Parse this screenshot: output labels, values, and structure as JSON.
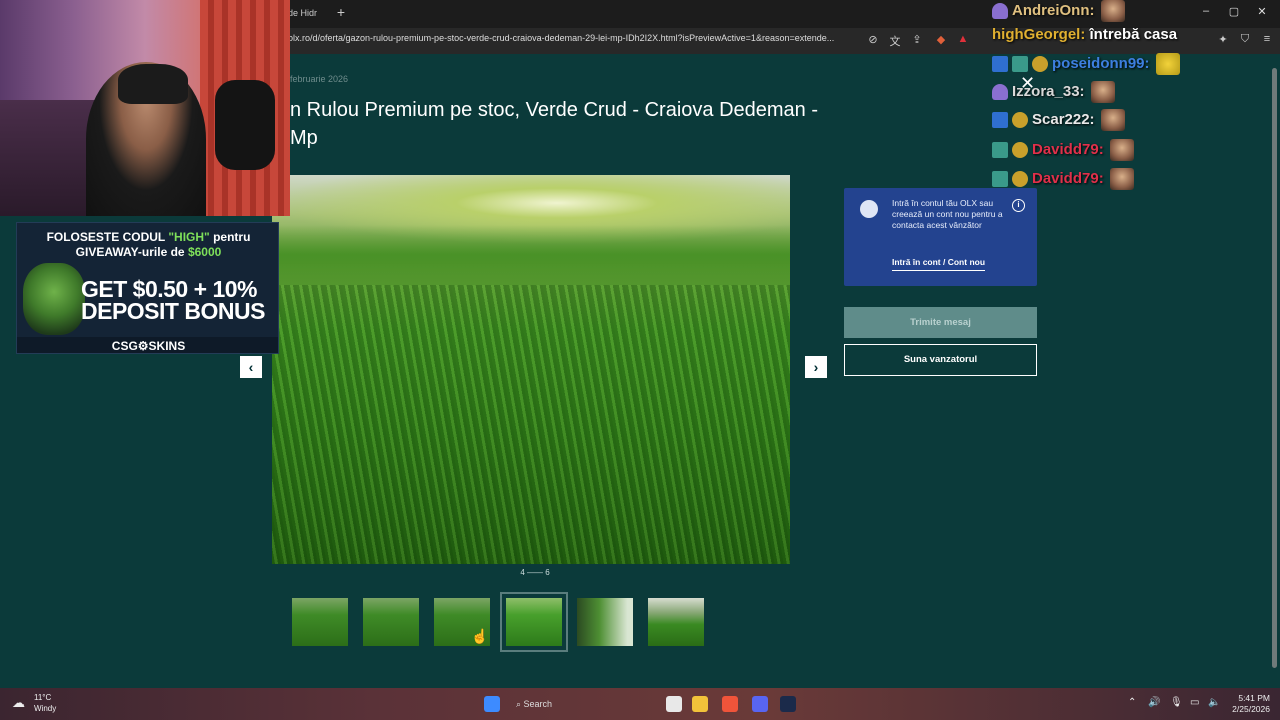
{
  "browser": {
    "tab_title": "de Hidr",
    "new_tab": "+",
    "url": "olx.ro/d/oferta/gazon-rulou-premium-pe-stoc-verde-crud-craiova-dedeman-29-lei-mp-IDh2I2X.html?isPreviewActive=1&reason=extende...",
    "window_controls": [
      "–",
      "▢",
      "✕"
    ]
  },
  "listing": {
    "date": "februarie 2026",
    "title": "n Rulou Premium pe stoc, Verde Crud - Craiova Dedeman - Mp",
    "prev": "‹",
    "next": "›",
    "image_counter_current": "4",
    "image_counter_total": "6",
    "thumbnail_count": 6,
    "selected_thumbnail": 4
  },
  "sidebar": {
    "login_text": "Intră în contul tău OLX sau creează un cont nou pentru a contacta acest vânzător",
    "info": "i",
    "login_link": "Intră în cont / Cont nou",
    "send_message": "Trimite mesaj",
    "call_seller": "Suna vanzatorul"
  },
  "ad": {
    "line1_a": "FOLOSESTE CODUL ",
    "line1_code": "\"HIGH\"",
    "line1_b": " pentru",
    "line2_a": "GIVEAWAY-urile de ",
    "line2_amount": "$6000",
    "big1": "GET $0.50 + 10%",
    "big2": "DEPOSIT BONUS",
    "footer": "CSG⚙SKINS"
  },
  "chat": [
    {
      "user": "AndreiOnn:",
      "color": "#e0c080",
      "message": ""
    },
    {
      "user": "highGeorgel:",
      "color": "#e0b030",
      "message": " întrebă casa"
    },
    {
      "user": "poseidonn99:",
      "color": "#3d7fe0",
      "message": ""
    },
    {
      "user": "Izzora_33:",
      "color": "#d9d9d9",
      "message": ""
    },
    {
      "user": "Scar222:",
      "color": "#e8e8e8",
      "message": ""
    },
    {
      "user": "Davidd79:",
      "color": "#e0304a",
      "message": ""
    },
    {
      "user": "Davidd79:",
      "color": "#e0304a",
      "message": ""
    }
  ],
  "taskbar": {
    "weather_temp": "11°C",
    "weather_desc": "Windy",
    "search": "Search",
    "time": "5:41 PM",
    "date": "2/25/2026"
  }
}
